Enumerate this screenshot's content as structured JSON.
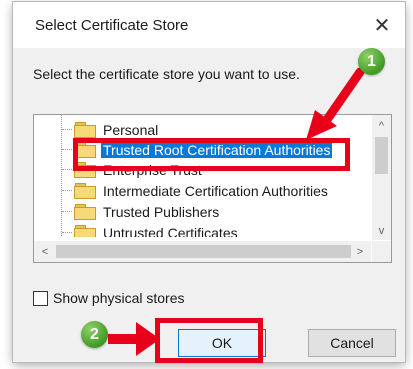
{
  "dialog": {
    "title": "Select Certificate Store",
    "close_glyph": "✕",
    "instruction": "Select the certificate store you want to use."
  },
  "tree": {
    "items": [
      {
        "label": "Personal",
        "selected": false
      },
      {
        "label": "Trusted Root Certification Authorities",
        "selected": true
      },
      {
        "label": "Enterprise Trust",
        "selected": false
      },
      {
        "label": "Intermediate Certification Authorities",
        "selected": false
      },
      {
        "label": "Trusted Publishers",
        "selected": false
      },
      {
        "label": "Untrusted Certificates",
        "selected": false
      }
    ],
    "scroll_up_glyph": "^",
    "scroll_down_glyph": "v",
    "scroll_left_glyph": "<",
    "scroll_right_glyph": ">"
  },
  "options": {
    "show_physical_stores_label": "Show physical stores",
    "show_physical_stores_checked": false
  },
  "buttons": {
    "ok_label": "OK",
    "cancel_label": "Cancel"
  },
  "annotations": {
    "step1": "1",
    "step2": "2",
    "highlight_color": "#e8001a",
    "badge_color": "#4caf2e"
  },
  "colors": {
    "selection": "#0a78d7",
    "dialog_bg": "#f0f0f0"
  }
}
